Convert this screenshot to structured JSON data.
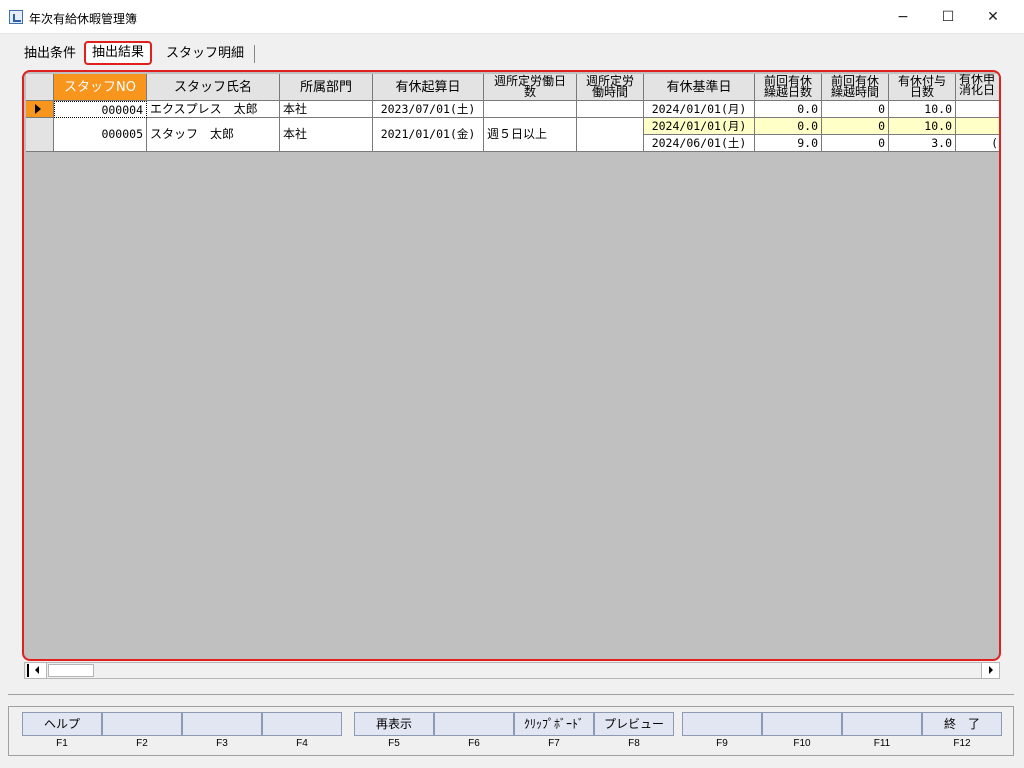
{
  "window": {
    "title": "年次有給休暇管理簿",
    "controls": {
      "minimize": "−",
      "maximize": "☐",
      "close": "✕"
    }
  },
  "tabs": [
    {
      "label": "抽出条件",
      "selected": false
    },
    {
      "label": "抽出結果",
      "selected": true
    },
    {
      "label": "スタッフ明細",
      "selected": false
    }
  ],
  "grid": {
    "columns": [
      {
        "line1": "スタッフNO",
        "line2": ""
      },
      {
        "line1": "スタッフ氏名",
        "line2": ""
      },
      {
        "line1": "所属部門",
        "line2": ""
      },
      {
        "line1": "有休起算日",
        "line2": ""
      },
      {
        "line1": "週所定労働日",
        "line2": "数"
      },
      {
        "line1": "週所定労",
        "line2": "働時間"
      },
      {
        "line1": "有休基準日",
        "line2": ""
      },
      {
        "line1": "前回有休",
        "line2": "繰越日数"
      },
      {
        "line1": "前回有休",
        "line2": "繰越時間"
      },
      {
        "line1": "有休付与",
        "line2": "日数"
      },
      {
        "line1": "有休申",
        "line2": "消化日"
      }
    ],
    "rows": [
      {
        "staff_no": "000004",
        "name": "エクスプレス　太郎",
        "dept": "本社",
        "start_date": "2023/07/01(土)",
        "weekly_days": "",
        "weekly_hours": "",
        "sub": [
          {
            "base_date": "2024/01/01(月)",
            "carry_days": "0.0",
            "carry_hours": "0",
            "grant_days": "10.0",
            "used": ""
          }
        ]
      },
      {
        "staff_no": "000005",
        "name": "スタッフ　太郎",
        "dept": "本社",
        "start_date": "2021/01/01(金)",
        "weekly_days": "週５日以上",
        "weekly_hours": "",
        "sub": [
          {
            "base_date": "2024/01/01(月)",
            "carry_days": "0.0",
            "carry_hours": "0",
            "grant_days": "10.0",
            "used": ""
          },
          {
            "base_date": "2024/06/01(土)",
            "carry_days": "9.0",
            "carry_hours": "0",
            "grant_days": "3.0",
            "used": "("
          }
        ]
      }
    ]
  },
  "function_keys": [
    {
      "label": "ヘルプ",
      "key": "F1"
    },
    {
      "label": "",
      "key": "F2"
    },
    {
      "label": "",
      "key": "F3"
    },
    {
      "label": "",
      "key": "F4"
    },
    {
      "label": "再表示",
      "key": "F5"
    },
    {
      "label": "",
      "key": "F6"
    },
    {
      "label": "ｸﾘｯﾌﾟﾎﾞｰﾄﾞ",
      "key": "F7"
    },
    {
      "label": "プレビュー",
      "key": "F8"
    },
    {
      "label": "",
      "key": "F9"
    },
    {
      "label": "",
      "key": "F10"
    },
    {
      "label": "",
      "key": "F11"
    },
    {
      "label": "終　了",
      "key": "F12"
    }
  ],
  "colors": {
    "accent_red": "#e01f1f",
    "selected_header": "#f7951d",
    "highlight_row": "#ffffc8",
    "grid_background": "#c0c0c0",
    "fkey_background": "#e1e6f2"
  }
}
